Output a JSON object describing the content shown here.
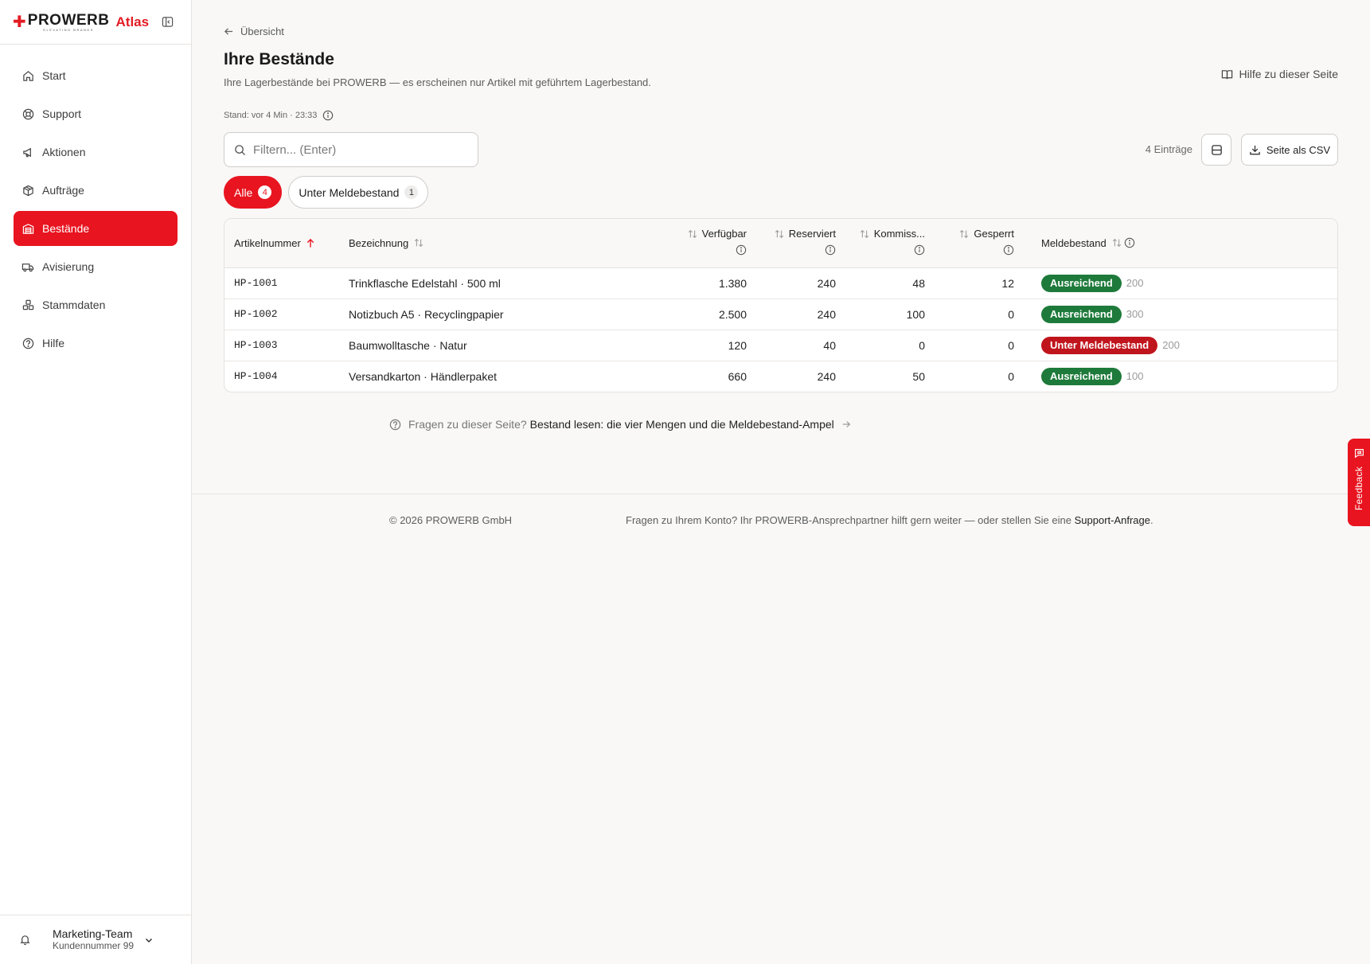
{
  "brand": {
    "name": "PROWERB",
    "tagline": "ELEVATING BRANDS",
    "product": "Atlas"
  },
  "nav": [
    {
      "label": "Start",
      "icon": "home-icon",
      "active": false
    },
    {
      "label": "Support",
      "icon": "lifebuoy-icon",
      "active": false
    },
    {
      "label": "Aktionen",
      "icon": "megaphone-icon",
      "active": false
    },
    {
      "label": "Aufträge",
      "icon": "package-icon",
      "active": false
    },
    {
      "label": "Bestände",
      "icon": "warehouse-icon",
      "active": true
    },
    {
      "label": "Avisierung",
      "icon": "truck-icon",
      "active": false
    },
    {
      "label": "Stammdaten",
      "icon": "boxes-icon",
      "active": false
    },
    {
      "label": "Hilfe",
      "icon": "help-circle-icon",
      "active": false
    }
  ],
  "account": {
    "name": "Marketing-Team",
    "customer_number": "Kundennummer 99"
  },
  "page": {
    "back_label": "Übersicht",
    "title": "Ihre Bestände",
    "subtitle": "Ihre Lagerbestände bei PROWERB — es erscheinen nur Artikel mit geführtem Lagerbestand.",
    "help_label": "Hilfe zu dieser Seite",
    "stand": "Stand: vor 4 Min · 23:33"
  },
  "toolbar": {
    "search_placeholder": "Filtern... (Enter)",
    "entries": "4 Einträge",
    "csv_label": "Seite als CSV"
  },
  "chips": [
    {
      "label": "Alle",
      "count": "4",
      "active": true
    },
    {
      "label": "Unter Meldebestand",
      "count": "1",
      "active": false
    }
  ],
  "table": {
    "columns": {
      "sku": "Artikelnummer",
      "name": "Bezeichnung",
      "available": "Verfügbar",
      "reserved": "Reserviert",
      "picking": "Kommiss...",
      "blocked": "Gesperrt",
      "threshold": "Meldebestand"
    },
    "rows": [
      {
        "sku": "HP-1001",
        "name": "Trinkflasche Edelstahl · 500 ml",
        "available": "1.380",
        "reserved": "240",
        "picking": "48",
        "blocked": "12",
        "status": "Ausreichend",
        "status_type": "ok",
        "threshold": "200"
      },
      {
        "sku": "HP-1002",
        "name": "Notizbuch A5 · Recyclingpapier",
        "available": "2.500",
        "reserved": "240",
        "picking": "100",
        "blocked": "0",
        "status": "Ausreichend",
        "status_type": "ok",
        "threshold": "300"
      },
      {
        "sku": "HP-1003",
        "name": "Baumwolltasche · Natur",
        "available": "120",
        "reserved": "40",
        "picking": "0",
        "blocked": "0",
        "status": "Unter Meldebestand",
        "status_type": "low",
        "threshold": "200"
      },
      {
        "sku": "HP-1004",
        "name": "Versandkarton · Händlerpaket",
        "available": "660",
        "reserved": "240",
        "picking": "50",
        "blocked": "0",
        "status": "Ausreichend",
        "status_type": "ok",
        "threshold": "100"
      }
    ]
  },
  "faq": {
    "prefix": "Fragen zu dieser Seite?",
    "link": "Bestand lesen: die vier Mengen und die Meldebestand-Ampel"
  },
  "footer": {
    "copyright": "© 2026 PROWERB GmbH",
    "text": "Fragen zu Ihrem Konto? Ihr PROWERB-Ansprechpartner hilft gern weiter — oder stellen Sie eine",
    "link": "Support-Anfrage",
    "end": "."
  },
  "feedback_label": "Feedback",
  "colors": {
    "accent": "#e8141f",
    "ok": "#1e7a3a",
    "low": "#c0151d"
  }
}
